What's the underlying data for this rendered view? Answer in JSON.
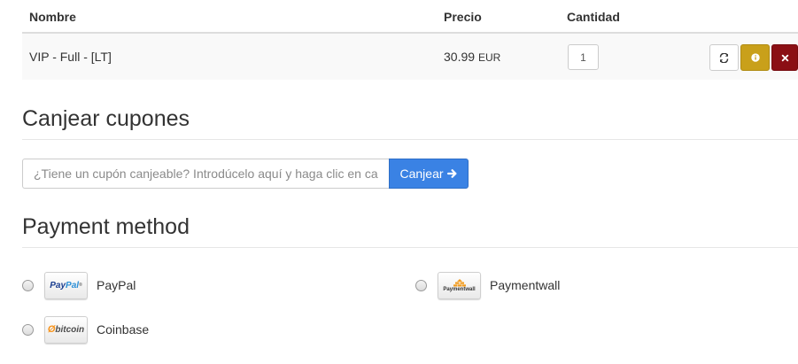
{
  "cart": {
    "headers": {
      "name": "Nombre",
      "price": "Precio",
      "quantity": "Cantidad"
    },
    "items": [
      {
        "name": "VIP - Full - [LT]",
        "price": "30.99",
        "currency": "EUR",
        "quantity": "1"
      }
    ],
    "actions": [
      "refresh-icon",
      "info-icon",
      "remove-icon"
    ]
  },
  "coupons": {
    "title": "Canjear cupones",
    "placeholder": "¿Tiene un cupón canjeable? Introdúcelo aquí y haga clic en canjear",
    "button_label": "Canjear"
  },
  "payment": {
    "title": "Payment method",
    "methods": [
      {
        "name": "PayPal",
        "logo": "paypal-logo"
      },
      {
        "name": "Paymentwall",
        "logo": "paymentwall-logo"
      },
      {
        "name": "Coinbase",
        "logo": "bitcoin-logo"
      }
    ]
  },
  "colors": {
    "primary_button": "#3a82e4",
    "info_button": "#c9a01a",
    "danger_button": "#8b0f14"
  }
}
